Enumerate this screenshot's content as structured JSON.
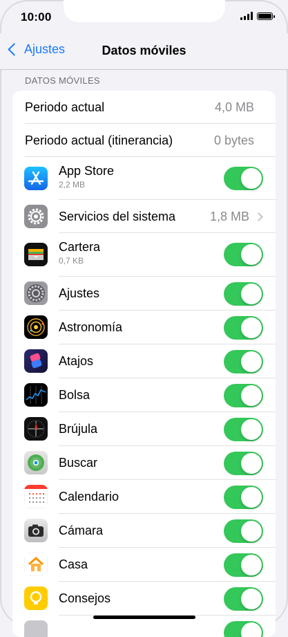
{
  "status_bar": {
    "time": "10:00"
  },
  "nav": {
    "back_label": "Ajustes",
    "title": "Datos móviles"
  },
  "section_header": "DATOS MÓVILES",
  "usage": [
    {
      "label": "Periodo actual",
      "value": "4,0 MB"
    },
    {
      "label": "Periodo actual (itinerancia)",
      "value": "0 bytes"
    }
  ],
  "apps": [
    {
      "name": "App Store",
      "subtitle": "2,2 MB",
      "icon": "app-store-icon",
      "toggle_on": true
    },
    {
      "name": "Servicios del sistema",
      "value": "1,8 MB",
      "icon": "gear-icon"
    },
    {
      "name": "Cartera",
      "subtitle": "0,7 KB",
      "icon": "wallet-icon",
      "toggle_on": true
    },
    {
      "name": "Ajustes",
      "icon": "settings-icon",
      "toggle_on": true
    },
    {
      "name": "Astronomía",
      "icon": "astronomy-icon",
      "toggle_on": true
    },
    {
      "name": "Atajos",
      "icon": "shortcuts-icon",
      "toggle_on": true
    },
    {
      "name": "Bolsa",
      "icon": "stocks-icon",
      "toggle_on": true
    },
    {
      "name": "Brújula",
      "icon": "compass-icon",
      "toggle_on": true
    },
    {
      "name": "Buscar",
      "icon": "find-my-icon",
      "toggle_on": true
    },
    {
      "name": "Calendario",
      "icon": "calendar-icon",
      "toggle_on": true
    },
    {
      "name": "Cámara",
      "icon": "camera-icon",
      "toggle_on": true
    },
    {
      "name": "Casa",
      "icon": "home-icon",
      "toggle_on": true
    },
    {
      "name": "Consejos",
      "icon": "tips-icon",
      "toggle_on": true
    }
  ],
  "colors": {
    "accent": "#1a7bff",
    "toggle_on": "#34c759",
    "background": "#f2f2f7"
  }
}
